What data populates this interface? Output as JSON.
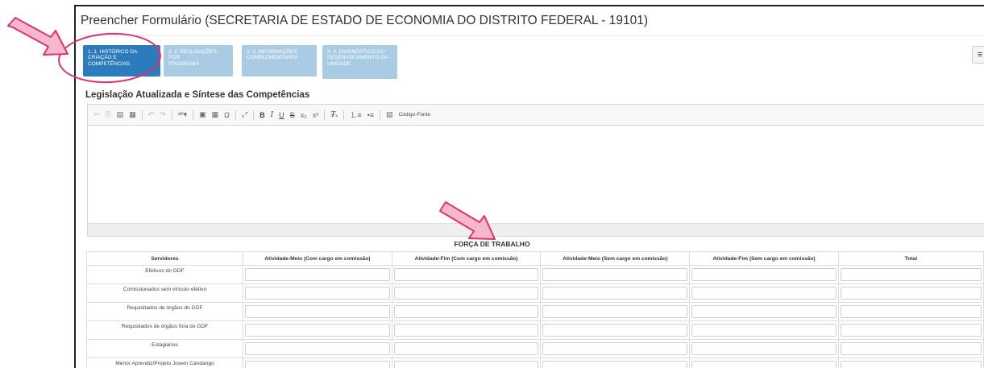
{
  "header": {
    "title": "Preencher Formulário (SECRETARIA DE ESTADO DE ECONOMIA DO DISTRITO FEDERAL - 19101)"
  },
  "steps": [
    {
      "line1": "1. 1. HISTÓRICO DA",
      "line2": "CRIAÇÃO E",
      "line3": "COMPETÊNCIAS",
      "state": "active"
    },
    {
      "line1": "2. 2. REALIZAÇÕES POR",
      "line2": "PROGRAMA",
      "line3": "",
      "state": "inactive"
    },
    {
      "line1": "3. 3. INFORMAÇÕES",
      "line2": "COMPLEMENTARES",
      "line3": "",
      "state": "inactive"
    },
    {
      "line1": "4. 4. DIAGNÓSTICO DO",
      "line2": "DESENVOLVIMENTO DA",
      "line3": "UNIDADE",
      "state": "inactive"
    }
  ],
  "section": {
    "heading": "Legislação Atualizada e Síntese das Competências"
  },
  "editor": {
    "source_label": "Código-Fonte",
    "toolbar_icons": [
      "cut-icon",
      "copy-icon",
      "paste-icon",
      "paste-text-icon",
      "undo-icon",
      "redo-icon",
      "spellcheck-icon",
      "image-icon",
      "table-icon",
      "special-char-icon",
      "maximize-icon",
      "bold-icon",
      "italic-icon",
      "underline-icon",
      "strike-icon",
      "subscript-icon",
      "superscript-icon",
      "remove-format-icon",
      "numbered-list-icon",
      "bulleted-list-icon",
      "source-icon"
    ]
  },
  "workforce": {
    "title": "FORÇA DE TRABALHO",
    "columns": [
      "Servidores",
      "Atividade-Meio (Com cargo em comissão)",
      "Atividade-Fim (Com cargo em comissão)",
      "Atividade-Meio (Sem cargo em comissão)",
      "Atividade-Fim (Sem cargo em comissão)",
      "Total"
    ],
    "rows": [
      "Efetivos do GDF",
      "Comissionados sem vínculo efetivo",
      "Requisitados de órgãos do GDF",
      "Requisitados de órgãos fora do GDF",
      "Estagiários",
      "Menor Aprendiz/Projeto Jovem Candango"
    ]
  },
  "colors": {
    "step_active": "#2c7bbd",
    "step_inactive": "#a9cbe4",
    "annotation": "#e0336b"
  }
}
